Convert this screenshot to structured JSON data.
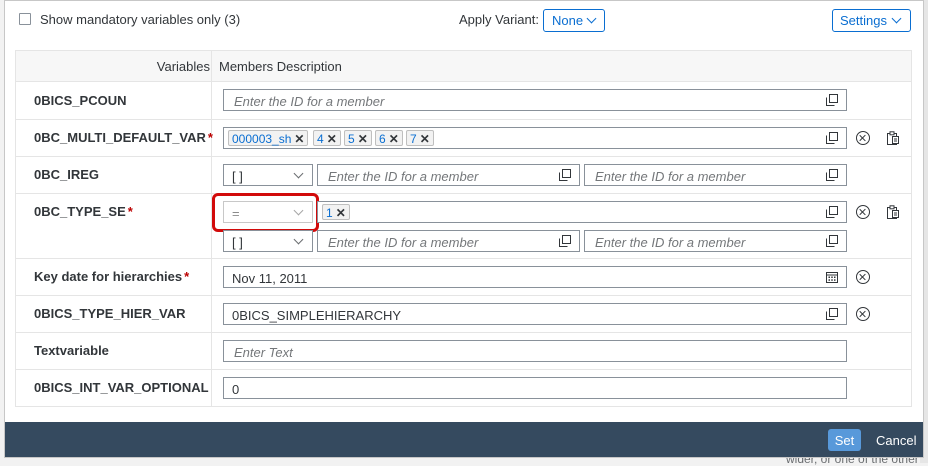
{
  "header": {
    "mandatory_only_label": "Show mandatory variables only (3)",
    "apply_variant_label": "Apply Variant:",
    "variant_value": "None",
    "settings_label": "Settings"
  },
  "table": {
    "col_variables": "Variables",
    "col_members": "Members Description",
    "rows": [
      {
        "name": "0BICS_PCOUN",
        "required": false,
        "placeholder": "Enter the ID for a member"
      },
      {
        "name": "0BC_MULTI_DEFAULT_VAR",
        "required": true,
        "tokens": [
          "000003_sh",
          "4",
          "5",
          "6",
          "7"
        ]
      },
      {
        "name": "0BC_IREG",
        "required": false,
        "operator": "[ ]",
        "from_placeholder": "Enter the ID for a member",
        "to_placeholder": "Enter the ID for a member"
      },
      {
        "name": "0BC_TYPE_SE",
        "required": true,
        "operator": "=",
        "tokens": [
          "1"
        ],
        "operator2": "[ ]",
        "from_placeholder": "Enter the ID for a member",
        "to_placeholder": "Enter the ID for a member"
      },
      {
        "name": "Key date for hierarchies",
        "required": true,
        "value": "Nov 11, 2011"
      },
      {
        "name": "0BICS_TYPE_HIER_VAR",
        "required": false,
        "value": "0BICS_SIMPLEHIERARCHY"
      },
      {
        "name": "Textvariable",
        "required": false,
        "placeholder": "Enter Text"
      },
      {
        "name": "0BICS_INT_VAR_OPTIONAL",
        "required": false,
        "value": "0"
      }
    ]
  },
  "footer": {
    "set_label": "Set",
    "cancel_label": "Cancel"
  },
  "background_hint": "wider, or one of the other",
  "required_marker": "*",
  "token_remove": "✕",
  "icons": [
    "value-help-icon",
    "clear-icon",
    "clipboard-icon",
    "calendar-icon",
    "chevron-down-icon"
  ],
  "colors": {
    "accent": "#0a6ed1",
    "footer": "#354a5f",
    "set_button": "#5899da",
    "required": "#bb0000",
    "highlight": "#d20a0a"
  }
}
